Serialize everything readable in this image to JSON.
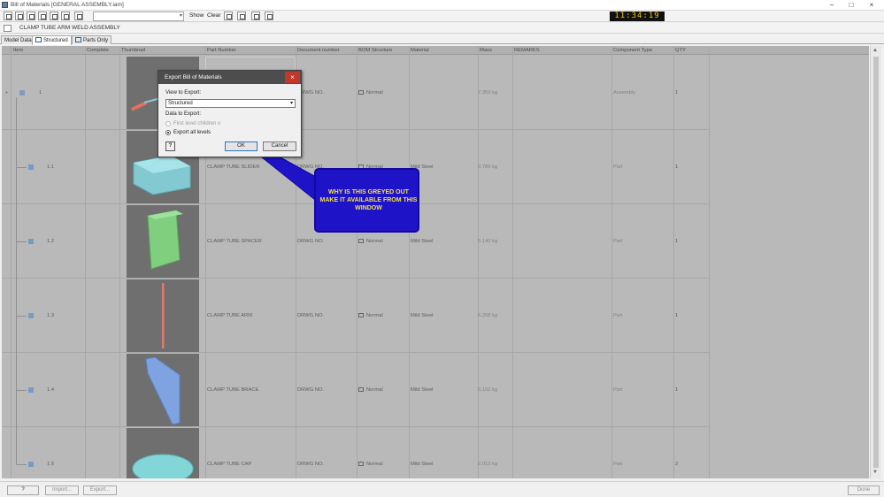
{
  "window": {
    "title": "Bill of Materials [GENERAL ASSEMBLY.iam]",
    "controls": {
      "minimize": "–",
      "maximize": "□",
      "close": "×"
    }
  },
  "toolbar": {
    "show_label": "Show",
    "clear_label": "Clear",
    "clock": "11:34:19"
  },
  "assembly": {
    "name": "CLAMP TUBE ARM WELD ASSEMBLY"
  },
  "tabs": [
    {
      "label": "Model Data"
    },
    {
      "label": "Structured"
    },
    {
      "label": "Parts Only"
    }
  ],
  "grid": {
    "columns": [
      "Item",
      "Complete",
      "Thumbnail",
      "Part Number",
      "Document number",
      "BOM Structure",
      "Material",
      "Mass",
      "REMARKS",
      "Component Type",
      "QTY"
    ],
    "rows": [
      {
        "item": "1",
        "part_number": "",
        "document_number": "DRWG NO.",
        "bom_structure": "Normal",
        "material": "",
        "mass": "7.359 kg",
        "component_type": "Assembly",
        "qty": "1"
      },
      {
        "item": "1.1",
        "part_number": "CLAMP TUBE SLIDER",
        "document_number": "DRWG NO.",
        "bom_structure": "Normal",
        "material": "Mild Steel",
        "mass": "0.789 kg",
        "component_type": "Part",
        "qty": "1"
      },
      {
        "item": "1.2",
        "part_number": "CLAMP TUBE SPACER",
        "document_number": "DRWG NO.",
        "bom_structure": "Normal",
        "material": "Mild Steel",
        "mass": "0.140 kg",
        "component_type": "Part",
        "qty": "1"
      },
      {
        "item": "1.3",
        "part_number": "CLAMP TUBE ARM",
        "document_number": "DRWG NO.",
        "bom_structure": "Normal",
        "material": "Mild Steel",
        "mass": "6.258 kg",
        "component_type": "Part",
        "qty": "1"
      },
      {
        "item": "1.4",
        "part_number": "CLAMP TUBE BRACE",
        "document_number": "DRWG NO.",
        "bom_structure": "Normal",
        "material": "Mild Steel",
        "mass": "0.152 kg",
        "component_type": "Part",
        "qty": "1"
      },
      {
        "item": "1.5",
        "part_number": "CLAMP TUBE CAP",
        "document_number": "DRWG NO.",
        "bom_structure": "Normal",
        "material": "Mild Steel",
        "mass": "0.013 kg",
        "component_type": "Part",
        "qty": "2"
      }
    ]
  },
  "bottom": {
    "help_label": "?",
    "import_label": "Import...",
    "export_label": "Export...",
    "done_label": "Done"
  },
  "dialog": {
    "title": "Export Bill of Materials",
    "close_label": "×",
    "view_label": "View to Export:",
    "view_value": "Structured",
    "data_label": "Data to Export:",
    "option_first_level": "First level children o",
    "option_all_levels": "Export all levels",
    "ok_label": "OK",
    "cancel_label": "Cancel",
    "help_label": "?"
  },
  "annotation": {
    "text": "WHY IS THIS GREYED OUT MAKE IT AVAILABLE FROM THIS WINDOW",
    "fill": "#1f13c8",
    "text_color": "#f2e24a"
  }
}
